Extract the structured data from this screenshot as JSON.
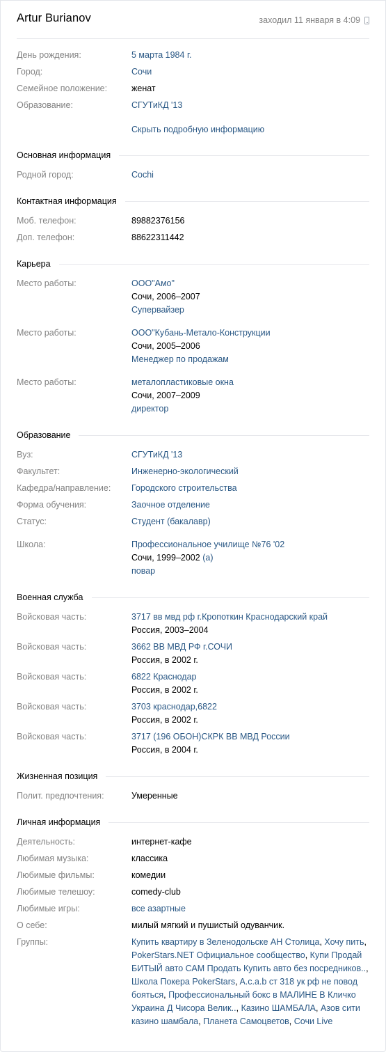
{
  "profile": {
    "name": "Artur Burianov",
    "last_seen": "заходил 11 января в 4:09",
    "device_icon": "mobile-phone-icon"
  },
  "brief": [
    {
      "label": "День рождения:",
      "value": "5 марта 1984 г.",
      "link": true
    },
    {
      "label": "Город:",
      "value": "Сочи",
      "link": true
    },
    {
      "label": "Семейное положение:",
      "value": "женат",
      "link": false
    },
    {
      "label": "Образование:",
      "value": "СГУТиКД '13",
      "link": true
    }
  ],
  "hide_details_link": "Скрыть подробную информацию",
  "sections": {
    "main": {
      "title": "Основная информация",
      "hometown_label": "Родной город:",
      "hometown_value": "Cochi"
    },
    "contacts": {
      "title": "Контактная информация",
      "mobile_label": "Моб. телефон:",
      "mobile_value": "89882376156",
      "extra_label": "Доп. телефон:",
      "extra_value": "88622311442"
    },
    "career": {
      "title": "Карьера",
      "jobs": [
        {
          "label": "Место работы:",
          "company": "ООО\"Амо\"",
          "place": "Сочи, 2006–2007",
          "position": "Супервайзер"
        },
        {
          "label": "Место работы:",
          "company": "ООО\"Кубань-Метало-Конструкции",
          "place": "Сочи, 2005–2006",
          "position": "Менеджер по продажам"
        },
        {
          "label": "Место работы:",
          "company": "металопластиковые окна",
          "place": "Сочи, 2007–2009",
          "position": "директор"
        }
      ]
    },
    "education": {
      "title": "Образование",
      "rows": [
        {
          "label": "Вуз:",
          "value": "СГУТиКД '13"
        },
        {
          "label": "Факультет:",
          "value": "Инженерно-экологический"
        },
        {
          "label": "Кафедра/направление:",
          "value": "Городского строительства"
        },
        {
          "label": "Форма обучения:",
          "value": "Заочное отделение"
        },
        {
          "label": "Статус:",
          "value": "Студент (бакалавр)"
        }
      ],
      "school": {
        "label": "Школа:",
        "name": "Профессиональное училище №76 '02",
        "place": "Сочи, 1999–2002",
        "class": "(а)",
        "specialty": "повар"
      }
    },
    "military": {
      "title": "Военная служба",
      "units": [
        {
          "label": "Войсковая часть:",
          "unit": "3717 вв мвд рф г.Кропоткин Краснодарский край",
          "info": "Россия, 2003–2004"
        },
        {
          "label": "Войсковая часть:",
          "unit": "3662 ВВ МВД РФ г.СОЧИ",
          "info": "Россия, в 2002 г."
        },
        {
          "label": "Войсковая часть:",
          "unit": "6822 Краснодар",
          "info": "Россия, в 2002 г."
        },
        {
          "label": "Войсковая часть:",
          "unit": "3703 краснодар,6822",
          "info": "Россия, в 2002 г."
        },
        {
          "label": "Войсковая часть:",
          "unit": "3717 (196 ОБОН)СКРК ВВ МВД России",
          "info": "Россия, в 2004 г."
        }
      ]
    },
    "position": {
      "title": "Жизненная позиция",
      "politics_label": "Полит. предпочтения:",
      "politics_value": "Умеренные"
    },
    "personal": {
      "title": "Личная информация",
      "rows": [
        {
          "label": "Деятельность:",
          "value": "интернет-кафе",
          "link": false
        },
        {
          "label": "Любимая музыка:",
          "value": "классика",
          "link": false
        },
        {
          "label": "Любимые фильмы:",
          "value": "комедии",
          "link": false
        },
        {
          "label": "Любимые телешоу:",
          "value": "comedy-club",
          "link": false
        },
        {
          "label": "Любимые игры:",
          "value": "все азартные",
          "link": true
        },
        {
          "label": "О себе:",
          "value": "милый мягкий и пушистый одуванчик.",
          "link": false
        }
      ],
      "groups_label": "Группы:",
      "groups": [
        "Купить квартиру в Зеленодольске АН Столица",
        "Хочу пить",
        "PokerStars.NET Официальное сообщество",
        "Купи Продай БИТЫЙ авто САМ Продать Купить авто без посредников..",
        "Школа Покера PokerStars",
        "A.c.a.b ст 318 ук рф не повод бояться",
        "Профессиональный бокс в МАЛИНЕ В Кличко Украина Д Чисора Велик..",
        "Казино ШАМБАЛА",
        "Азов сити казино шамбала",
        "Планета Самоцветов",
        "Сочи Live"
      ]
    }
  },
  "colors": {
    "label": "#828282",
    "link": "#2a5885",
    "divider": "#e7e8ec"
  }
}
